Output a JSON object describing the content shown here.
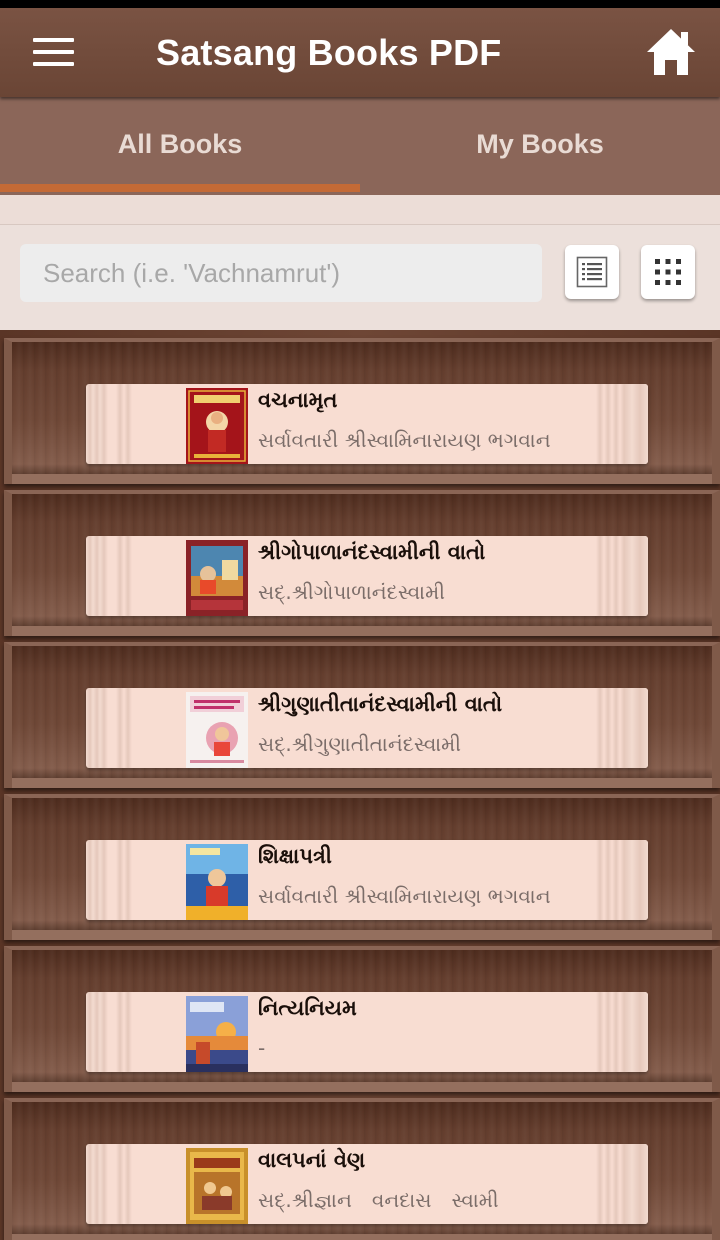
{
  "app": {
    "title": "Satsang Books PDF",
    "menu_icon": "hamburger-menu-icon",
    "home_icon": "home-icon",
    "colors": {
      "app_bar": "#6f4939",
      "tab_bar": "#8b6659",
      "tab_indicator": "#c46a36",
      "book_spine": "#f8ddd2"
    }
  },
  "tabs": [
    {
      "label": "All Books",
      "selected": true
    },
    {
      "label": "My Books",
      "selected": false
    }
  ],
  "search": {
    "placeholder": "Search (i.e. 'Vachnamrut')",
    "value": ""
  },
  "view_toggle": {
    "list_icon": "list-view-icon",
    "grid_icon": "grid-view-icon"
  },
  "books": [
    {
      "title": "વચનામૃત",
      "author": "સર્વાવતારી શ્રીસ્વામિનારાયણ ભગવાન",
      "cover": "red"
    },
    {
      "title": "શ્રીગોપાળાનંદસ્વામીની વાતો",
      "author": "સદ્.શ્રીગોપાળાનંદસ્વામી",
      "cover": "maroon"
    },
    {
      "title": "શ્રીગુણાતીતાનંદસ્વામીની વાતો",
      "author": "સદ્.શ્રીગુણાતીતાનંદસ્વામી",
      "cover": "white"
    },
    {
      "title": "શિક્ષાપત્રી",
      "author": "સર્વાવતારી શ્રીસ્વામિનારાયણ ભગવાન",
      "cover": "blue"
    },
    {
      "title": "નિત્યનિયમ",
      "author": "-",
      "cover": "sunset"
    },
    {
      "title": "વાલપનાં વેણ",
      "author": "સદ્.શ્રીજ્ઞાન વનદાસ સ્વામી",
      "cover": "gold"
    }
  ]
}
